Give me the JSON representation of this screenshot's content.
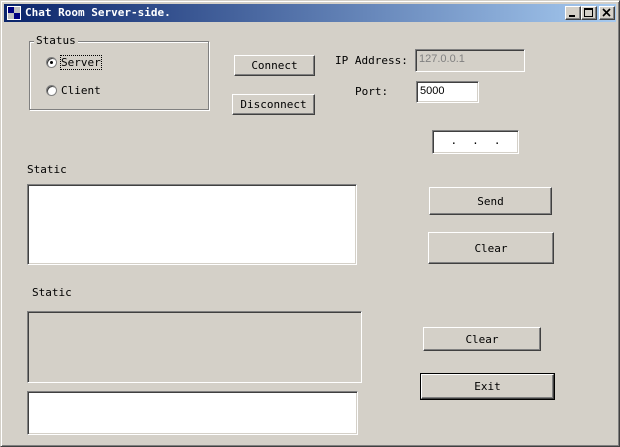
{
  "window": {
    "title": "Chat Room Server-side.",
    "icons": {
      "app": "app-icon",
      "minimize": "minimize-icon",
      "maximize": "maximize-icon",
      "close": "close-icon"
    },
    "titlebar_colors": [
      "#0a246a",
      "#a6caf0"
    ]
  },
  "status_group": {
    "label": "Status",
    "options": [
      {
        "label": "Server",
        "selected": true
      },
      {
        "label": "Client",
        "selected": false
      }
    ]
  },
  "buttons": {
    "connect": "Connect",
    "disconnect": "Disconnect",
    "send": "Send",
    "clear_top": "Clear",
    "clear_bottom": "Clear",
    "exit": "Exit"
  },
  "ip_address": {
    "label": "IP Address:",
    "value": "127.0.0.1"
  },
  "port": {
    "label": "Port:",
    "value": "5000"
  },
  "ip_control": {
    "dots": [
      ".",
      ".",
      "."
    ]
  },
  "static_labels": {
    "top": "Static",
    "bottom": "Static"
  },
  "message_box": {
    "value": ""
  },
  "log_box": {
    "value": ""
  },
  "input_box": {
    "value": ""
  }
}
